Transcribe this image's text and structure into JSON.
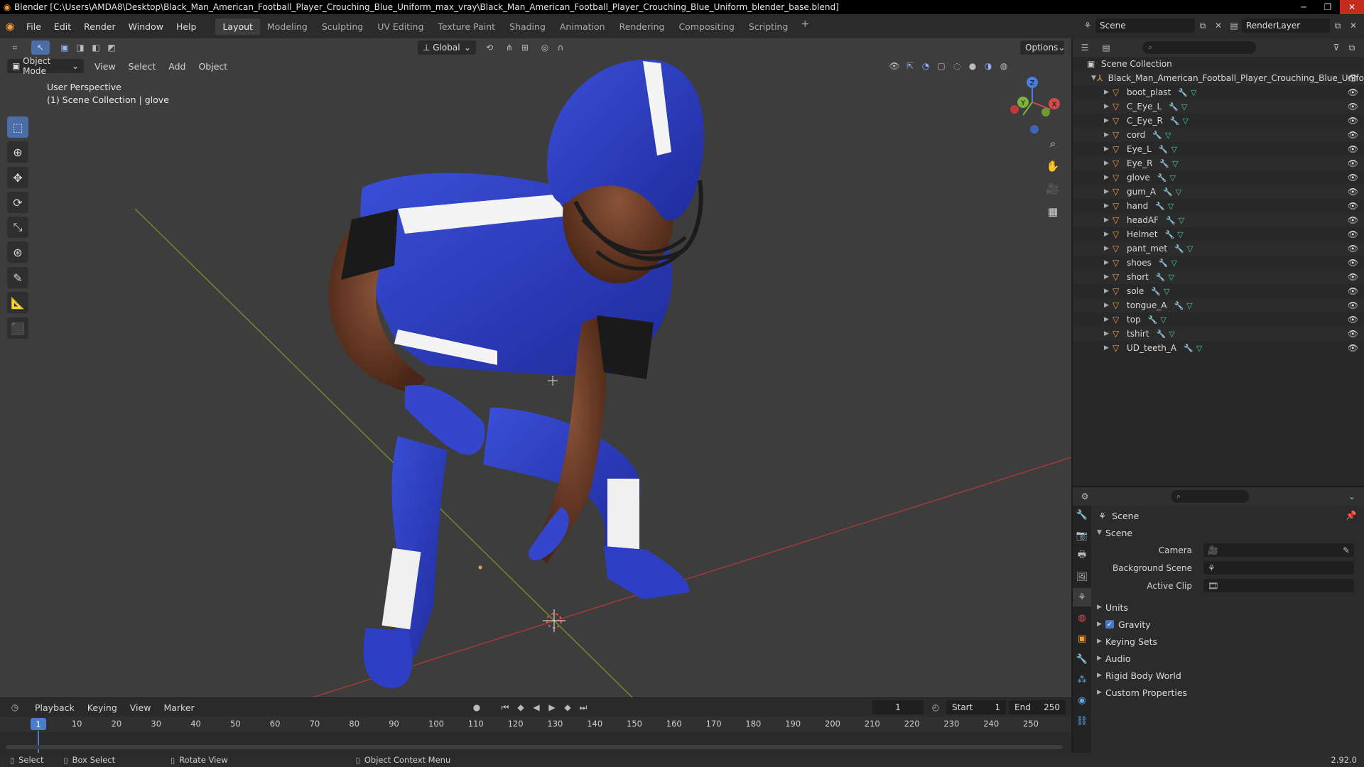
{
  "window": {
    "title": "Blender [C:\\Users\\AMDA8\\Desktop\\Black_Man_American_Football_Player_Crouching_Blue_Uniform_max_vray\\Black_Man_American_Football_Player_Crouching_Blue_Uniform_blender_base.blend]"
  },
  "menu": [
    "File",
    "Edit",
    "Render",
    "Window",
    "Help"
  ],
  "workspaces": [
    "Layout",
    "Modeling",
    "Sculpting",
    "UV Editing",
    "Texture Paint",
    "Shading",
    "Animation",
    "Rendering",
    "Compositing",
    "Scripting"
  ],
  "active_workspace": "Layout",
  "scene_selector": "Scene",
  "renderlayer_selector": "RenderLayer",
  "viewport": {
    "transform_orientation": "Global",
    "options_label": "Options",
    "mode": "Object Mode",
    "header_menus": [
      "View",
      "Select",
      "Add",
      "Object"
    ],
    "info_line1": "User Perspective",
    "info_line2": "(1) Scene Collection | glove",
    "axis_x": "X",
    "axis_y": "Y",
    "axis_z": "Z"
  },
  "outliner": {
    "root": "Scene Collection",
    "collection": "Black_Man_American_Football_Player_Crouching_Blue_Unifo",
    "objects": [
      "boot_plast",
      "C_Eye_L",
      "C_Eye_R",
      "cord",
      "Eye_L",
      "Eye_R",
      "glove",
      "gum_A",
      "hand",
      "headAF",
      "Helmet",
      "pant_met",
      "shoes",
      "short",
      "sole",
      "tongue_A",
      "top",
      "tshirt",
      "UD_teeth_A"
    ]
  },
  "properties": {
    "context_title": "Scene",
    "panel_title": "Scene",
    "camera_label": "Camera",
    "background_scene_label": "Background Scene",
    "active_clip_label": "Active Clip",
    "collapsed_panels": {
      "units": "Units",
      "gravity": "Gravity",
      "keying_sets": "Keying Sets",
      "audio": "Audio",
      "rigid_body_world": "Rigid Body World",
      "custom_properties": "Custom Properties"
    },
    "gravity_checked": true
  },
  "timeline": {
    "menus": [
      "Playback",
      "Keying",
      "View",
      "Marker"
    ],
    "current_frame": "1",
    "start_label": "Start",
    "start_value": "1",
    "end_label": "End",
    "end_value": "250",
    "ruler": [
      "1",
      "10",
      "20",
      "30",
      "40",
      "50",
      "60",
      "70",
      "80",
      "90",
      "100",
      "110",
      "120",
      "130",
      "140",
      "150",
      "160",
      "170",
      "180",
      "190",
      "200",
      "210",
      "220",
      "230",
      "240",
      "250"
    ]
  },
  "statusbar": {
    "select": "Select",
    "box_select": "Box Select",
    "rotate_view": "Rotate View",
    "context_menu": "Object Context Menu",
    "version": "2.92.0"
  }
}
